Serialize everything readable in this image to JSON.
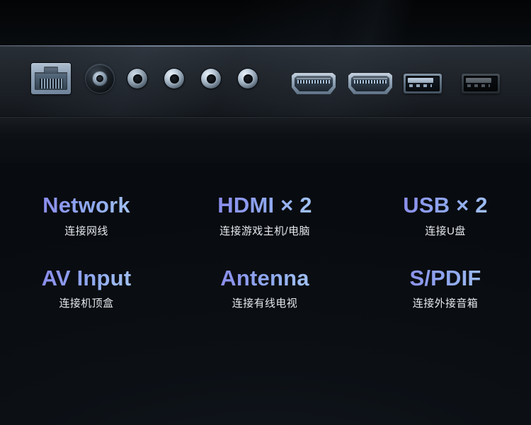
{
  "scene": {
    "description": "Television rear I/O panel product photo with bilingual port callouts",
    "background_color": "#0c1014",
    "panel_color": "#232931",
    "accent_gradient_start": "#7f7ce6",
    "accent_gradient_end": "#b2d3f6",
    "caption_sub_color": "#e6ebf1"
  },
  "ports": [
    {
      "id": "ethernet",
      "icon": "ethernet-rj45-port-icon",
      "label": "RJ45 Ethernet"
    },
    {
      "id": "antenna",
      "icon": "coaxial-antenna-port-icon",
      "label": "Coaxial antenna"
    },
    {
      "id": "rca-1",
      "icon": "rca-jack-icon",
      "label": "AV jack 1"
    },
    {
      "id": "rca-2",
      "icon": "rca-jack-icon",
      "label": "AV jack 2"
    },
    {
      "id": "rca-3",
      "icon": "rca-jack-icon",
      "label": "AV jack 3"
    },
    {
      "id": "rca-4",
      "icon": "rca-jack-icon",
      "label": "AV jack 4"
    },
    {
      "id": "hdmi-1",
      "icon": "hdmi-port-icon",
      "label": "HDMI 1"
    },
    {
      "id": "hdmi-2",
      "icon": "hdmi-port-icon",
      "label": "HDMI 2"
    },
    {
      "id": "usb-1",
      "icon": "usb-a-port-icon",
      "label": "USB 1"
    },
    {
      "id": "usb-2",
      "icon": "usb-a-port-icon",
      "label": "USB 2"
    }
  ],
  "captions": {
    "rows": [
      [
        {
          "title": "Network",
          "sub": "连接网线"
        },
        {
          "title": "HDMI × 2",
          "sub": "连接游戏主机/电脑"
        },
        {
          "title": "USB × 2",
          "sub": "连接U盘"
        }
      ],
      [
        {
          "title": "AV Input",
          "sub": "连接机顶盒"
        },
        {
          "title": "Antenna",
          "sub": "连接有线电视"
        },
        {
          "title": "S/PDIF",
          "sub": "连接外接音箱"
        }
      ]
    ]
  }
}
